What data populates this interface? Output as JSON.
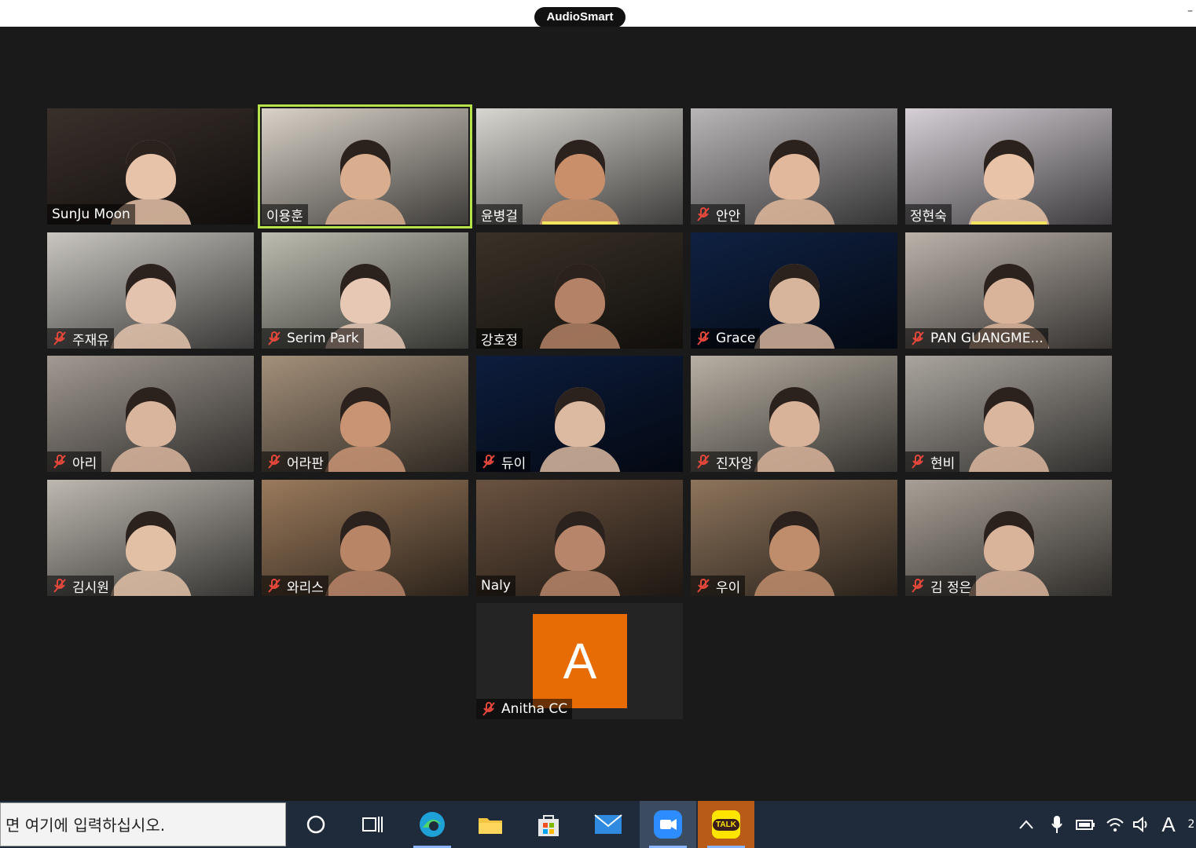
{
  "app": {
    "brand": "AudioSmart"
  },
  "participants": [
    {
      "name": "SunJu Moon",
      "muted": false,
      "active": false,
      "bg": "#3a302b",
      "skin": "#e7c3a9",
      "col": 0,
      "row": 0
    },
    {
      "name": "이용훈",
      "muted": false,
      "active": true,
      "bg": "#d9d2c8",
      "skin": "#d9ae8e",
      "col": 1,
      "row": 0
    },
    {
      "name": "윤병걸",
      "muted": false,
      "active": false,
      "bg": "#d8d6d0",
      "skin": "#c98f6a",
      "col": 2,
      "row": 0,
      "speaking": true
    },
    {
      "name": "안안",
      "muted": true,
      "active": false,
      "bg": "#b9b6b8",
      "skin": "#e1b89b",
      "col": 3,
      "row": 0
    },
    {
      "name": "정현숙",
      "muted": false,
      "active": false,
      "bg": "#d6d0d6",
      "skin": "#e9c3a7",
      "col": 4,
      "row": 0,
      "speaking": true
    },
    {
      "name": "주재유",
      "muted": true,
      "active": false,
      "bg": "#c9c6c0",
      "skin": "#e3c3ad",
      "col": 0,
      "row": 1
    },
    {
      "name": "Serim Park",
      "muted": true,
      "active": false,
      "bg": "#bcbcb0",
      "skin": "#e6c8b4",
      "col": 1,
      "row": 1
    },
    {
      "name": "강호정",
      "muted": false,
      "active": false,
      "bg": "#3a3228",
      "skin": "#b48266",
      "col": 2,
      "row": 1
    },
    {
      "name": "Grace",
      "muted": true,
      "active": false,
      "bg": "#0f2142",
      "skin": "#d7b59c",
      "col": 3,
      "row": 1
    },
    {
      "name": "PAN GUANGME...",
      "muted": true,
      "active": false,
      "bg": "#bbb2aa",
      "skin": "#d9b39a",
      "col": 4,
      "row": 1
    },
    {
      "name": "아리",
      "muted": true,
      "active": false,
      "bg": "#a29a92",
      "skin": "#d9b59e",
      "col": 0,
      "row": 2
    },
    {
      "name": "어라판",
      "muted": true,
      "active": false,
      "bg": "#a4907a",
      "skin": "#c99474",
      "col": 1,
      "row": 2
    },
    {
      "name": "듀이",
      "muted": true,
      "active": false,
      "bg": "#0d1d3d",
      "skin": "#dcbaa2",
      "col": 2,
      "row": 2
    },
    {
      "name": "진자앙",
      "muted": true,
      "active": false,
      "bg": "#b8b0a4",
      "skin": "#d8b39a",
      "col": 3,
      "row": 2
    },
    {
      "name": "현비",
      "muted": true,
      "active": false,
      "bg": "#aaa59e",
      "skin": "#dbb69e",
      "col": 4,
      "row": 2
    },
    {
      "name": "김시원",
      "muted": true,
      "active": false,
      "bg": "#bdb8b0",
      "skin": "#e1c0a6",
      "col": 0,
      "row": 3
    },
    {
      "name": "와리스",
      "muted": true,
      "active": false,
      "bg": "#9a7a5c",
      "skin": "#b98567",
      "col": 1,
      "row": 3
    },
    {
      "name": "Naly",
      "muted": false,
      "active": false,
      "bg": "#6a5240",
      "skin": "#b7866a",
      "col": 2,
      "row": 3
    },
    {
      "name": "우이",
      "muted": true,
      "active": false,
      "bg": "#8d745c",
      "skin": "#c08d6c",
      "col": 3,
      "row": 3
    },
    {
      "name": "김 정은",
      "muted": true,
      "active": false,
      "bg": "#a8a096",
      "skin": "#d9b39a",
      "col": 4,
      "row": 3
    }
  ],
  "avatar_participant": {
    "name": "Anitha CC",
    "initial": "A",
    "muted": true,
    "color": "#e86c06"
  },
  "taskbar": {
    "search_placeholder": "면 여기에 입력하십시오.",
    "kakao_label": "TALK",
    "ime_label": "A",
    "clock_fragment": "2"
  }
}
